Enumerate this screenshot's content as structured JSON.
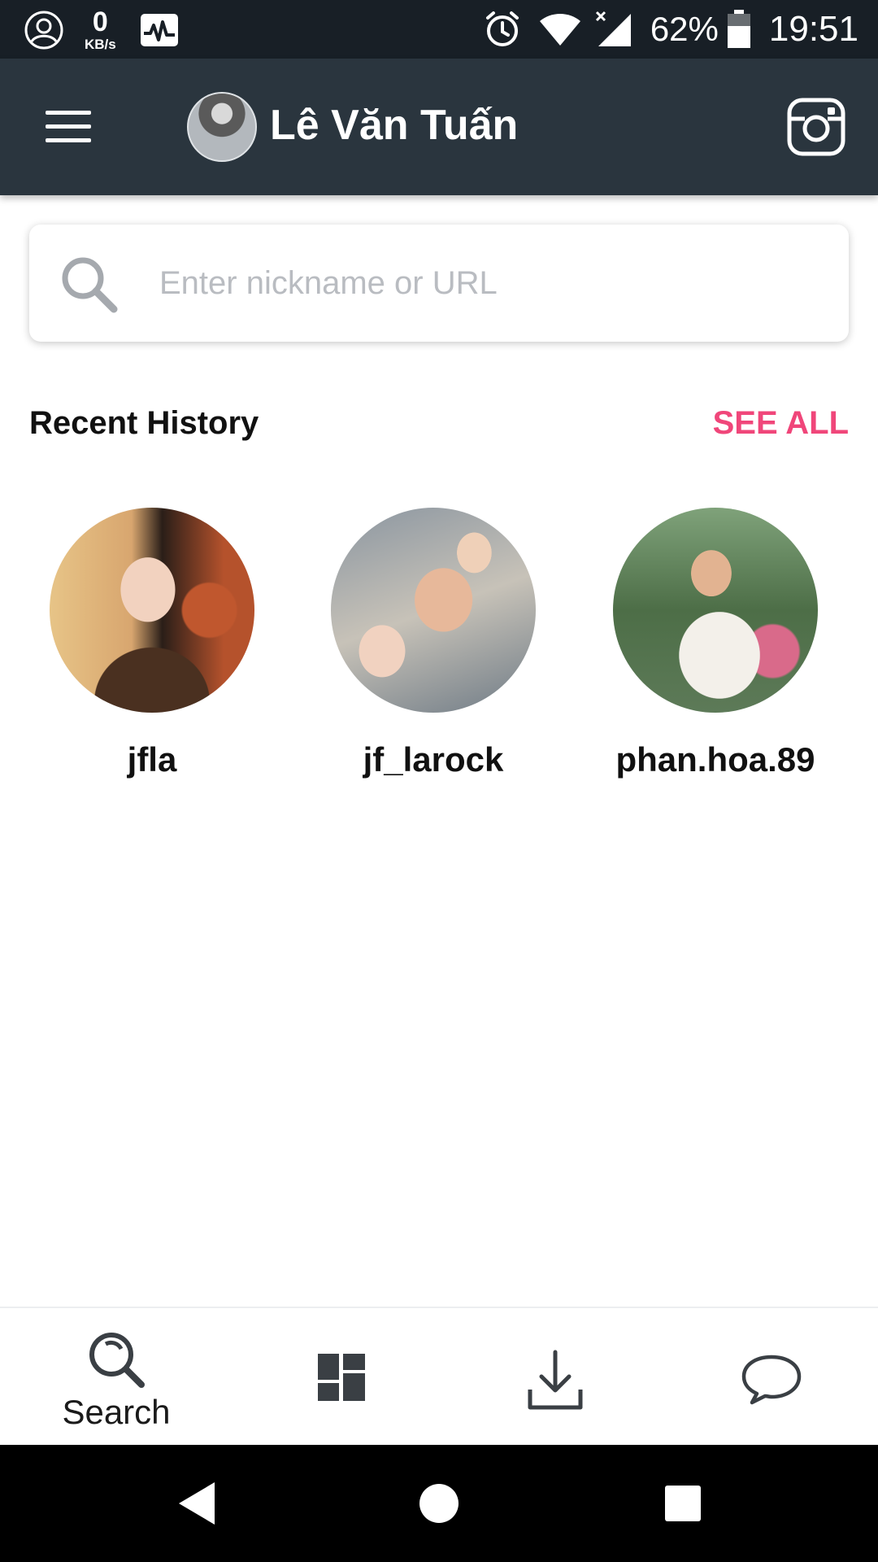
{
  "status_bar": {
    "net_speed_value": "0",
    "net_speed_unit": "KB/s",
    "battery_percent": "62%",
    "time": "19:51"
  },
  "app_bar": {
    "title": "Lê Văn Tuấn"
  },
  "search": {
    "placeholder": "Enter nickname or URL",
    "value": ""
  },
  "recent_history": {
    "title": "Recent History",
    "see_all_label": "SEE ALL",
    "items": [
      {
        "username": "jfla"
      },
      {
        "username": "jf_larock"
      },
      {
        "username": "phan.hoa.89"
      }
    ]
  },
  "bottom_nav": {
    "items": [
      {
        "label": "Search",
        "icon": "search-icon",
        "active": true
      },
      {
        "label": "",
        "icon": "dashboard-icon"
      },
      {
        "label": "",
        "icon": "download-icon"
      },
      {
        "label": "",
        "icon": "chat-bubble-icon"
      }
    ]
  },
  "colors": {
    "status_bar": "#181f26",
    "app_bar": "#2a353e",
    "accent": "#f0467a",
    "placeholder": "#b9bcc1",
    "nav_icon": "#3a3f44"
  },
  "icons": {
    "status_left": [
      "account-circle-icon",
      "activity-monitor-icon"
    ],
    "status_right": [
      "alarm-icon",
      "wifi-icon",
      "cell-signal-icon",
      "battery-icon"
    ],
    "app_bar": [
      "menu-icon",
      "instagram-icon"
    ],
    "system_nav": [
      "back-icon",
      "home-icon",
      "recents-icon"
    ]
  }
}
